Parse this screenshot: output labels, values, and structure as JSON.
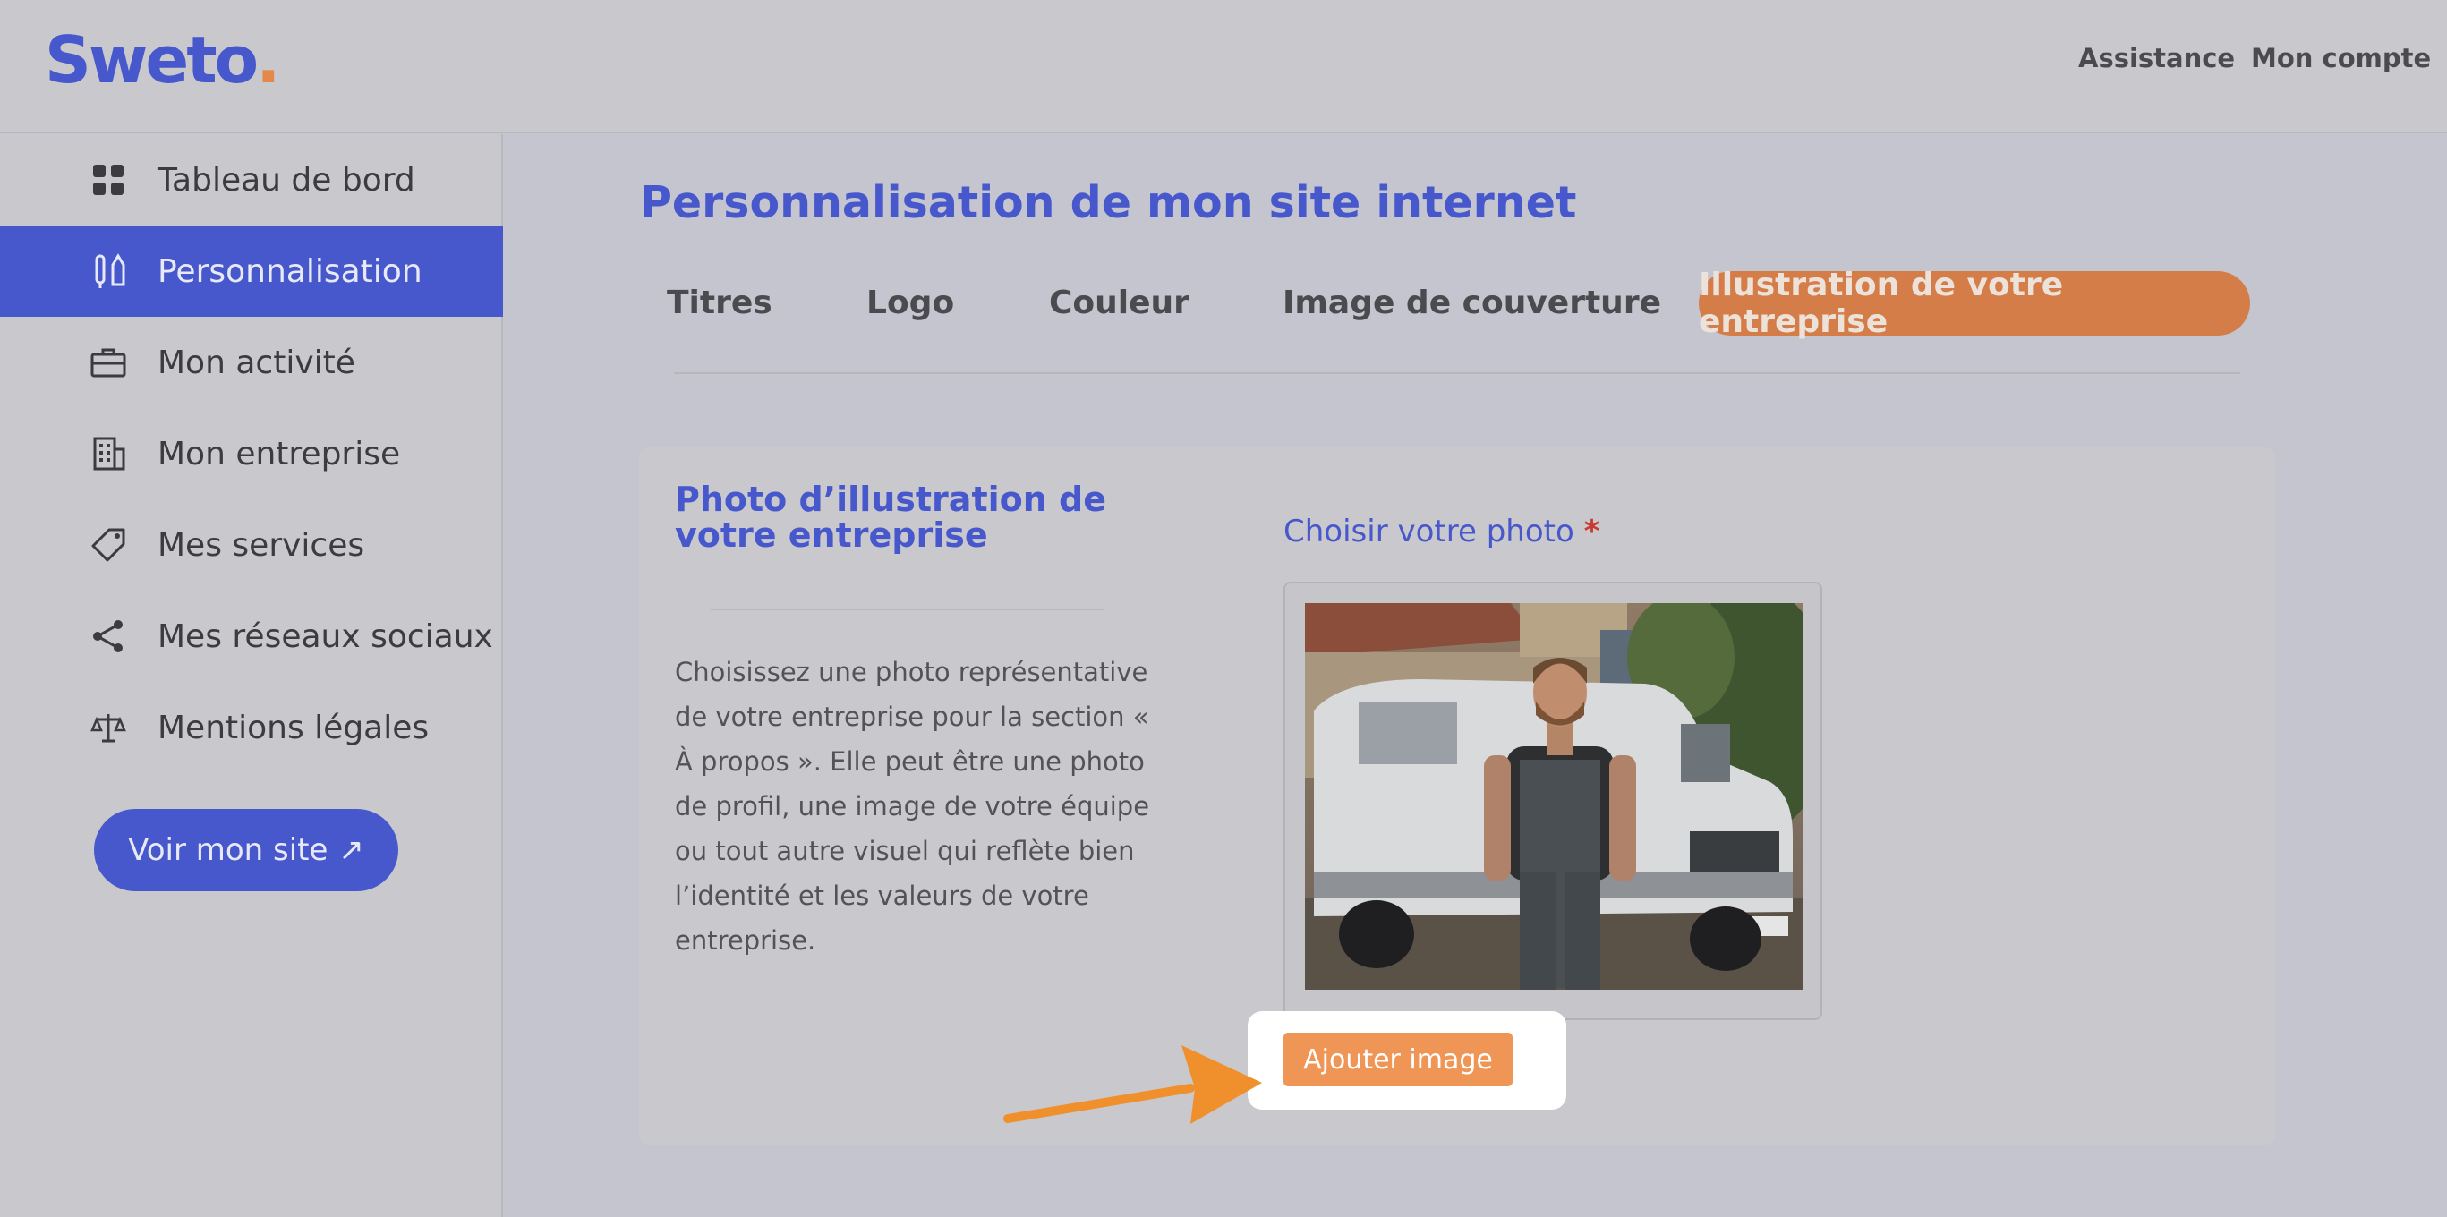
{
  "brand": {
    "name": "Sweto",
    "dot": "."
  },
  "header": {
    "links": [
      "Assistance",
      "Mon compte"
    ]
  },
  "sidebar": {
    "items": [
      {
        "label": "Tableau de bord",
        "icon": "dashboard-icon",
        "active": false
      },
      {
        "label": "Personnalisation",
        "icon": "brush-pen-icon",
        "active": true
      },
      {
        "label": "Mon activité",
        "icon": "briefcase-icon",
        "active": false
      },
      {
        "label": "Mon entreprise",
        "icon": "building-icon",
        "active": false
      },
      {
        "label": "Mes services",
        "icon": "tag-icon",
        "active": false
      },
      {
        "label": "Mes réseaux sociaux",
        "icon": "share-icon",
        "active": false
      },
      {
        "label": "Mentions légales",
        "icon": "scales-icon",
        "active": false
      }
    ],
    "site_button": {
      "label": "Voir mon site",
      "icon": "↗"
    }
  },
  "main": {
    "title": "Personnalisation de mon site internet",
    "tabs": [
      {
        "label": "Titres",
        "active": false
      },
      {
        "label": "Logo",
        "active": false
      },
      {
        "label": "Couleur",
        "active": false
      },
      {
        "label": "Image de couverture",
        "active": false
      },
      {
        "label": "Illustration de votre entreprise",
        "active": true
      }
    ],
    "card": {
      "title": "Photo d’illustration de votre entreprise",
      "description": "Choisissez une photo représentative de votre entreprise pour la section « À propos ». Elle peut être une photo de profil, une image de votre équipe ou tout autre visuel qui reflète bien l’identité et les valeurs de votre entreprise.",
      "photo_label": "Choisir votre photo",
      "required_mark": "*",
      "add_button": "Ajouter image"
    }
  },
  "colors": {
    "brand_blue": "#4757cc",
    "accent_orange": "#d57d48",
    "button_orange": "#ef9556",
    "arrow_orange": "#f0902d"
  }
}
